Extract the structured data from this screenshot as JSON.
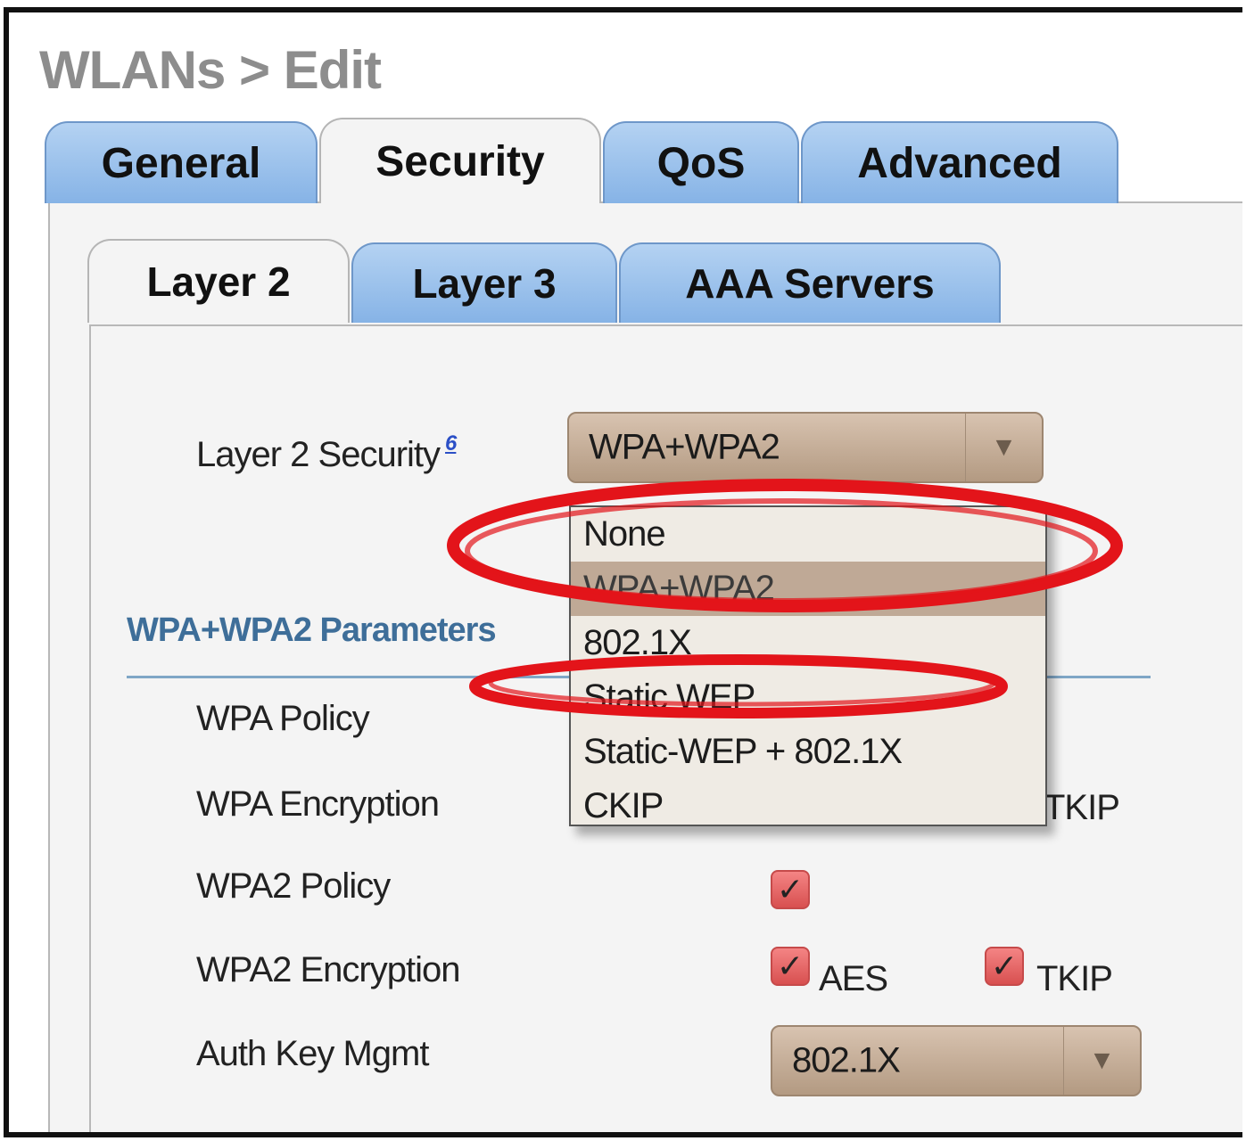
{
  "page": {
    "title": "WLANs > Edit"
  },
  "tabs": [
    {
      "label": "General"
    },
    {
      "label": "Security"
    },
    {
      "label": "QoS"
    },
    {
      "label": "Advanced"
    }
  ],
  "subtabs": [
    {
      "label": "Layer 2"
    },
    {
      "label": "Layer 3"
    },
    {
      "label": "AAA Servers"
    }
  ],
  "layer2_security": {
    "label": "Layer 2 Security",
    "footnote": "6",
    "selected": "WPA+WPA2",
    "options": [
      "None",
      "WPA+WPA2",
      "802.1X",
      "Static WEP",
      "Static-WEP + 802.1X",
      "CKIP"
    ],
    "highlighted_option": "WPA+WPA2"
  },
  "params": {
    "section_title": "WPA+WPA2 Parameters",
    "wpa_policy_label": "WPA Policy",
    "wpa_encryption_label": "WPA Encryption",
    "wpa_encryption_tkip": "TKIP",
    "wpa2_policy_label": "WPA2 Policy",
    "wpa2_policy_checked": true,
    "wpa2_encryption_label": "WPA2 Encryption",
    "wpa2_aes_label": "AES",
    "wpa2_aes_checked": true,
    "wpa2_tkip_label": "TKIP",
    "wpa2_tkip_checked": true,
    "auth_key_label": "Auth Key Mgmt",
    "auth_key_value": "802.1X"
  },
  "colors": {
    "tab_blue": "#9cc3ee",
    "select_tan": "#c7b09a",
    "checkbox_red": "#e06464",
    "annotation_red": "#e3141a",
    "section_blue": "#3e6e99"
  }
}
